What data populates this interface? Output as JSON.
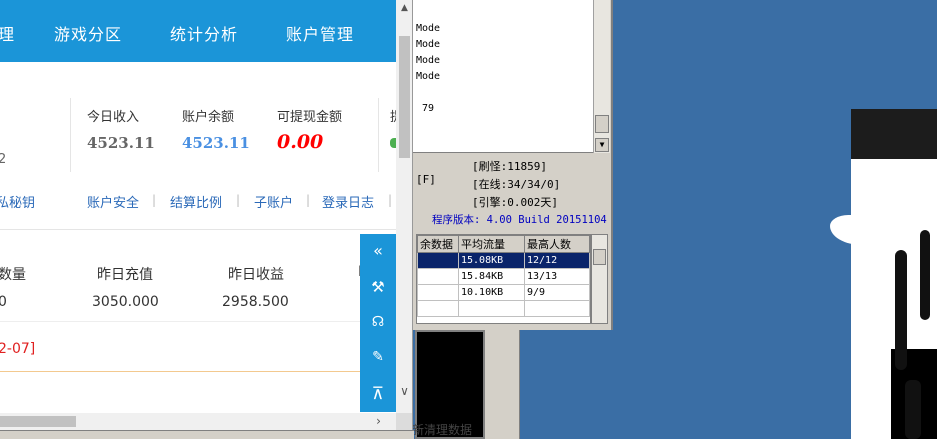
{
  "server_window": {
    "log_lines": [
      "Mode",
      "Mode",
      "Mode",
      "Mode",
      "79"
    ],
    "stats": {
      "flag": "[F]",
      "brush": "[刷怪:11859]",
      "online": "[在线:34/34/0]",
      "engine": "[引擎:0.002天]"
    },
    "version": "程序版本: 4.00 Build 20151104",
    "table": {
      "headers": [
        "余数据",
        "平均流量",
        "最高人数"
      ],
      "rows": [
        [
          "",
          "15.08KB",
          "12/12"
        ],
        [
          "",
          "15.84KB",
          "13/13"
        ],
        [
          "",
          "10.10KB",
          "9/9"
        ]
      ]
    },
    "bottom_status": "新清理数据"
  },
  "web_panel": {
    "nav": [
      "理",
      "游戏分区",
      "统计分析",
      "账户管理"
    ],
    "left_fragment": "2",
    "left_link": "私秘钥",
    "balances": {
      "today_income": {
        "label": "今日收入",
        "value": "4523.11",
        "color": "#666666"
      },
      "account_balance": {
        "label": "账户余额",
        "value": "4523.11",
        "color": "#4a90e2"
      },
      "withdrawable": {
        "label": "可提现金额",
        "value": "0.00",
        "color": "#ff0000"
      },
      "cut_label": "提"
    },
    "links": [
      "账户安全",
      "结算比例",
      "子账户",
      "登录日志"
    ],
    "stats": {
      "count_label": "数量",
      "count_value": "0",
      "recharge_label": "昨日充值",
      "recharge_value": "3050.000",
      "income_label": "昨日收益",
      "income_value": "2958.500",
      "cut_label": "I"
    },
    "date_text": "2-07]",
    "accent": "#1b95d8",
    "sidebar_icons": [
      "double-chevron-left-icon",
      "tools-icon",
      "headset-icon",
      "chat-bubble-icon",
      "back-to-top-icon"
    ]
  }
}
